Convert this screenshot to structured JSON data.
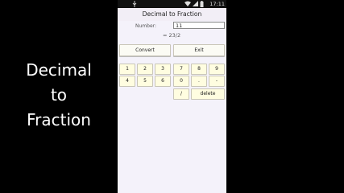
{
  "promo": {
    "lines": [
      "Decimal",
      "to",
      "Fraction"
    ]
  },
  "status": {
    "time": "17:11",
    "icons": [
      "usb-icon",
      "wifi-icon",
      "signal-icon",
      "battery-icon"
    ]
  },
  "app": {
    "title": "Decimal to Fraction",
    "number_label": "Number:",
    "number_value": "11",
    "result": "= 23/2",
    "convert_label": "Convert",
    "exit_label": "Exit",
    "left_keys": [
      "1",
      "2",
      "3",
      "4",
      "5",
      "6"
    ],
    "right_keys": [
      "7",
      "8",
      "9",
      "0",
      ".",
      "-",
      "/",
      "delete"
    ]
  }
}
